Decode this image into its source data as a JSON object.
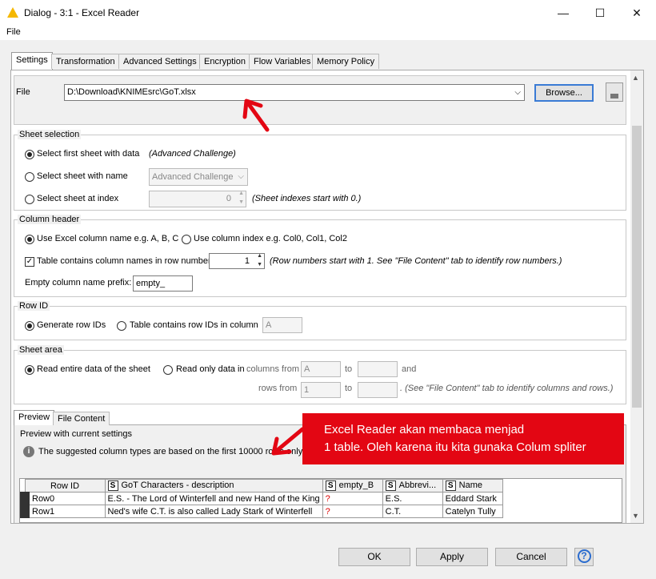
{
  "window": {
    "title": "Dialog - 3:1 - Excel Reader",
    "minimize": "—",
    "maximize": "☐",
    "close": "✕"
  },
  "menu": {
    "file": "File"
  },
  "tabs": [
    "Settings",
    "Transformation",
    "Advanced Settings",
    "Encryption",
    "Flow Variables",
    "Memory Policy"
  ],
  "file": {
    "label": "File",
    "path": "D:\\Download\\KNIMEsrc\\GoT.xlsx",
    "browse": "Browse..."
  },
  "sheet_selection": {
    "title": "Sheet selection",
    "opt1": "Select first sheet with data",
    "opt1_note": "(Advanced Challenge)",
    "opt2": "Select sheet with name",
    "opt2_value": "Advanced Challenge",
    "opt3": "Select sheet at index",
    "opt3_value": "0",
    "opt3_note": "(Sheet indexes start with 0.)"
  },
  "column_header": {
    "title": "Column header",
    "opt1": "Use Excel column name e.g. A, B, C",
    "opt2": "Use column index e.g. Col0, Col1, Col2",
    "check": "Table contains column names in row number",
    "row_number": "1",
    "note": "(Row numbers start with 1. See \"File Content\" tab to identify row numbers.)",
    "prefix_label": "Empty column name prefix:",
    "prefix_value": "empty_"
  },
  "row_id": {
    "title": "Row ID",
    "opt1": "Generate row IDs",
    "opt2": "Table contains row IDs in column",
    "column": "A"
  },
  "sheet_area": {
    "title": "Sheet area",
    "opt1": "Read entire data of the sheet",
    "opt2": "Read only data in",
    "columns_from": "columns from",
    "col_from_val": "A",
    "to": "to",
    "and": "and",
    "rows_from": "rows from",
    "row_from_val": "1",
    "note": ". (See \"File Content\" tab to identify columns and rows.)"
  },
  "preview_tabs": [
    "Preview",
    "File Content"
  ],
  "preview": {
    "title": "Preview with current settings",
    "info": "The suggested column types are based on the first 10000 rows only.",
    "headers": [
      "Row ID",
      "GoT Characters - description",
      "empty_B",
      "Abbrevi...",
      "Name"
    ],
    "rows": [
      [
        "Row0",
        "E.S. - The Lord of Winterfell and new Hand of the King",
        "?",
        "E.S.",
        "Eddard Stark"
      ],
      [
        "Row1",
        "Ned's wife C.T. is also called Lady Stark of Winterfell",
        "?",
        "C.T.",
        "Catelyn Tully"
      ]
    ]
  },
  "annotation": {
    "line1": "Excel Reader akan membaca menjad",
    "line2": "1 table. Oleh karena itu kita gunaka Colum spliter",
    "color": "#e30613"
  },
  "buttons": {
    "ok": "OK",
    "apply": "Apply",
    "cancel": "Cancel",
    "help": "?"
  }
}
